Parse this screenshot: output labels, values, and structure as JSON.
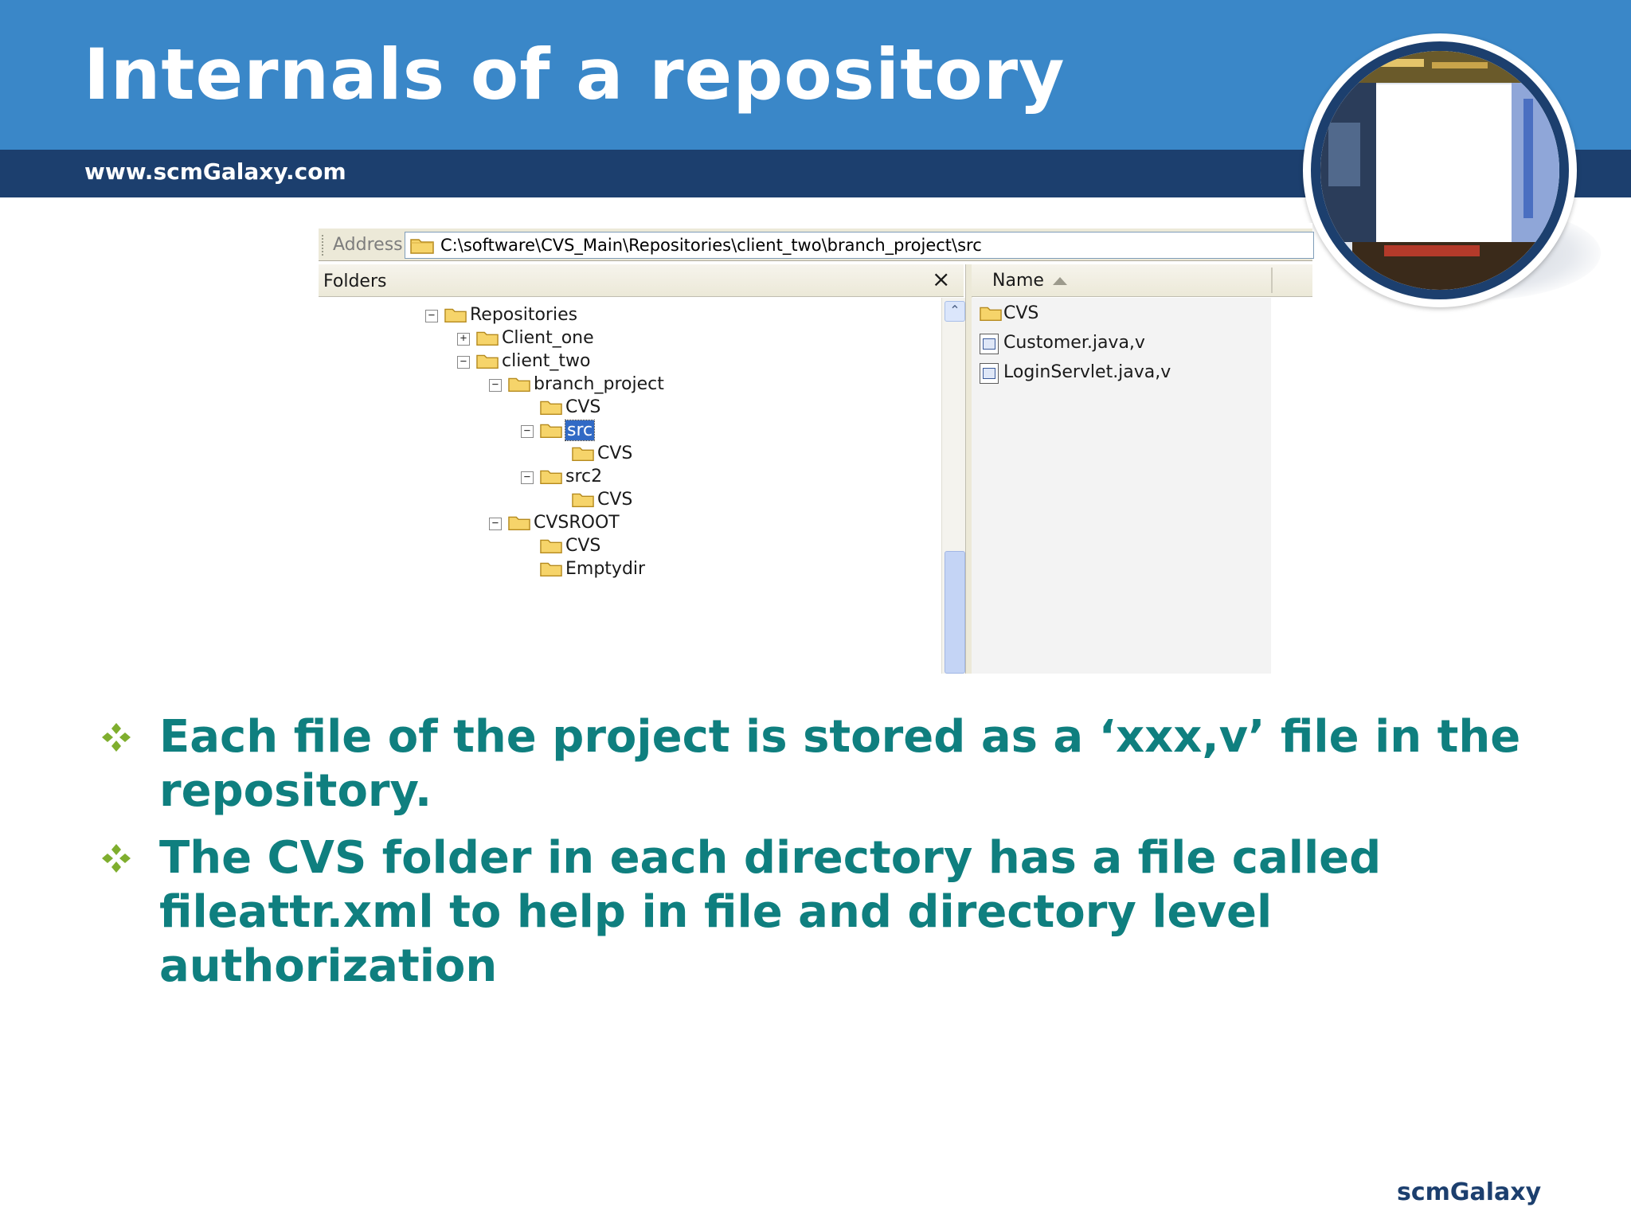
{
  "header": {
    "title": "Internals of a repository",
    "url": "www.scmGalaxy.com"
  },
  "colors": {
    "header_blue": "#3a87c8",
    "header_navy": "#1c3f6e",
    "bullet_teal": "#0f7f7f",
    "bullet_green": "#7fae2e",
    "selection_blue": "#316ac5"
  },
  "explorer": {
    "address_label": "Address",
    "address_path": "C:\\software\\CVS_Main\\Repositories\\client_two\\branch_project\\src",
    "folders_label": "Folders",
    "close_glyph": "×",
    "name_column": "Name",
    "tree": [
      {
        "label": "Repositories",
        "toggle": "−"
      },
      {
        "label": "Client_one",
        "toggle": "+"
      },
      {
        "label": "client_two",
        "toggle": "−"
      },
      {
        "label": "branch_project",
        "toggle": "−"
      },
      {
        "label": "CVS",
        "toggle": ""
      },
      {
        "label": "src",
        "toggle": "−",
        "selected": true
      },
      {
        "label": "CVS",
        "toggle": ""
      },
      {
        "label": "src2",
        "toggle": "−"
      },
      {
        "label": "CVS",
        "toggle": ""
      },
      {
        "label": "CVSROOT",
        "toggle": "−"
      },
      {
        "label": "CVS",
        "toggle": ""
      },
      {
        "label": "Emptydir",
        "toggle": ""
      }
    ],
    "files": [
      {
        "name": "CVS",
        "icon": "folder-icon"
      },
      {
        "name": "Customer.java,v",
        "icon": "file-icon"
      },
      {
        "name": "LoginServlet.java,v",
        "icon": "file-icon"
      }
    ]
  },
  "bullets": [
    "Each file of the project is stored as a ‘xxx,v’ file in the repository.",
    "The CVS folder in each directory has a file called fileattr.xml to help in file and directory level authorization"
  ],
  "footer": {
    "brand": "scmGalaxy"
  }
}
